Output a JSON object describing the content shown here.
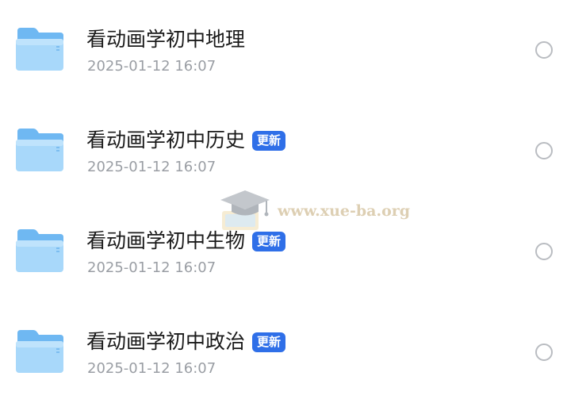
{
  "files": [
    {
      "name": "看动画学初中地理",
      "date": "2025-01-12 16:07",
      "badge": ""
    },
    {
      "name": "看动画学初中历史",
      "date": "2025-01-12 16:07",
      "badge": "更新"
    },
    {
      "name": "看动画学初中生物",
      "date": "2025-01-12 16:07",
      "badge": "更新"
    },
    {
      "name": "看动画学初中政治",
      "date": "2025-01-12 16:07",
      "badge": "更新"
    }
  ],
  "icons": {
    "folder": "folder-icon",
    "select": "radio-circle-icon"
  },
  "colors": {
    "folder_light": "#A8D8FA",
    "folder_dark": "#6FB8F2",
    "badge": "#2F6FE8",
    "date_text": "#9A9EA4",
    "radio_border": "#B9BCC1"
  },
  "watermark": {
    "text": "www.xue-ba.org"
  }
}
